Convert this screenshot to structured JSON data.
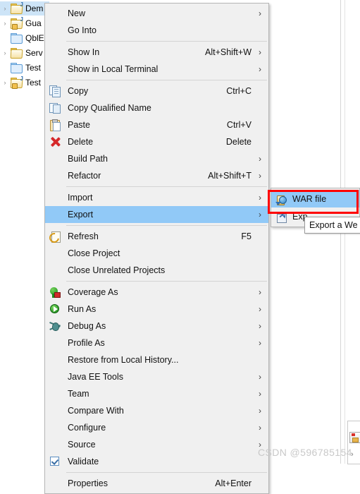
{
  "explorer": {
    "items": [
      {
        "label": "Dem",
        "twisty": "›",
        "icon": "java-project-folder-icon",
        "selected": true,
        "decorations": [
          "java-deco"
        ]
      },
      {
        "label": "Gua",
        "twisty": "›",
        "icon": "java-project-folder-icon",
        "selected": false,
        "decorations": [
          "java-deco",
          "lock-deco"
        ]
      },
      {
        "label": "QblE",
        "twisty": "",
        "icon": "folder-icon",
        "selected": false,
        "decorations": []
      },
      {
        "label": "Serv",
        "twisty": "›",
        "icon": "open-folder-icon",
        "selected": false,
        "decorations": []
      },
      {
        "label": "Test",
        "twisty": "",
        "icon": "folder-icon",
        "selected": false,
        "decorations": []
      },
      {
        "label": "Test",
        "twisty": "›",
        "icon": "java-project-folder-icon",
        "selected": false,
        "decorations": [
          "java-deco",
          "lock-deco"
        ]
      }
    ]
  },
  "context_menu": {
    "items": [
      {
        "kind": "item",
        "label": "New",
        "accel": "",
        "arrow": "›",
        "icon": "",
        "highlight": false
      },
      {
        "kind": "item",
        "label": "Go Into",
        "accel": "",
        "arrow": "",
        "icon": "",
        "highlight": false
      },
      {
        "kind": "separator"
      },
      {
        "kind": "item",
        "label": "Show In",
        "accel": "Alt+Shift+W",
        "arrow": "›",
        "icon": "",
        "highlight": false
      },
      {
        "kind": "item",
        "label": "Show in Local Terminal",
        "accel": "",
        "arrow": "›",
        "icon": "",
        "highlight": false
      },
      {
        "kind": "separator"
      },
      {
        "kind": "item",
        "label": "Copy",
        "accel": "Ctrl+C",
        "arrow": "",
        "icon": "copy-icon",
        "highlight": false
      },
      {
        "kind": "item",
        "label": "Copy Qualified Name",
        "accel": "",
        "arrow": "",
        "icon": "copy-qualified-icon",
        "highlight": false
      },
      {
        "kind": "item",
        "label": "Paste",
        "accel": "Ctrl+V",
        "arrow": "",
        "icon": "paste-icon",
        "highlight": false
      },
      {
        "kind": "item",
        "label": "Delete",
        "accel": "Delete",
        "arrow": "",
        "icon": "delete-icon",
        "highlight": false
      },
      {
        "kind": "item",
        "label": "Build Path",
        "accel": "",
        "arrow": "›",
        "icon": "",
        "highlight": false
      },
      {
        "kind": "item",
        "label": "Refactor",
        "accel": "Alt+Shift+T",
        "arrow": "›",
        "icon": "",
        "highlight": false
      },
      {
        "kind": "separator"
      },
      {
        "kind": "item",
        "label": "Import",
        "accel": "",
        "arrow": "›",
        "icon": "",
        "highlight": false
      },
      {
        "kind": "item",
        "label": "Export",
        "accel": "",
        "arrow": "›",
        "icon": "",
        "highlight": true
      },
      {
        "kind": "separator"
      },
      {
        "kind": "item",
        "label": "Refresh",
        "accel": "F5",
        "arrow": "",
        "icon": "refresh-icon",
        "highlight": false
      },
      {
        "kind": "item",
        "label": "Close Project",
        "accel": "",
        "arrow": "",
        "icon": "",
        "highlight": false
      },
      {
        "kind": "item",
        "label": "Close Unrelated Projects",
        "accel": "",
        "arrow": "",
        "icon": "",
        "highlight": false
      },
      {
        "kind": "separator"
      },
      {
        "kind": "item",
        "label": "Coverage As",
        "accel": "",
        "arrow": "›",
        "icon": "coverage-icon",
        "highlight": false
      },
      {
        "kind": "item",
        "label": "Run As",
        "accel": "",
        "arrow": "›",
        "icon": "run-icon",
        "highlight": false
      },
      {
        "kind": "item",
        "label": "Debug As",
        "accel": "",
        "arrow": "›",
        "icon": "debug-icon",
        "highlight": false
      },
      {
        "kind": "item",
        "label": "Profile As",
        "accel": "",
        "arrow": "›",
        "icon": "",
        "highlight": false
      },
      {
        "kind": "item",
        "label": "Restore from Local History...",
        "accel": "",
        "arrow": "",
        "icon": "",
        "highlight": false
      },
      {
        "kind": "item",
        "label": "Java EE Tools",
        "accel": "",
        "arrow": "›",
        "icon": "",
        "highlight": false
      },
      {
        "kind": "item",
        "label": "Team",
        "accel": "",
        "arrow": "›",
        "icon": "",
        "highlight": false
      },
      {
        "kind": "item",
        "label": "Compare With",
        "accel": "",
        "arrow": "›",
        "icon": "",
        "highlight": false
      },
      {
        "kind": "item",
        "label": "Configure",
        "accel": "",
        "arrow": "›",
        "icon": "",
        "highlight": false
      },
      {
        "kind": "item",
        "label": "Source",
        "accel": "",
        "arrow": "›",
        "icon": "",
        "highlight": false
      },
      {
        "kind": "checkitem",
        "label": "Validate",
        "accel": "",
        "arrow": "",
        "icon": "checkbox-checked-icon",
        "checked": true,
        "highlight": false
      },
      {
        "kind": "separator"
      },
      {
        "kind": "item",
        "label": "Properties",
        "accel": "Alt+Enter",
        "arrow": "",
        "icon": "",
        "highlight": false
      }
    ]
  },
  "export_submenu": {
    "items": [
      {
        "label": "WAR file",
        "icon": "war-file-icon",
        "highlight": true
      },
      {
        "label": "Exp",
        "icon": "ear-file-icon",
        "highlight": false
      }
    ]
  },
  "tooltip": {
    "text": "Export a We"
  },
  "annotation": {
    "color": "#ff0000",
    "target": "WAR file"
  },
  "watermark": {
    "text": "CSDN @596785154"
  },
  "colors": {
    "menu_background": "#f0f0f0",
    "menu_border": "#b6b6b6",
    "highlight": "#91c9f7",
    "tree_selection": "#cde4f7",
    "annotation_red": "#ff0000",
    "separator": "#d4d4d4"
  }
}
